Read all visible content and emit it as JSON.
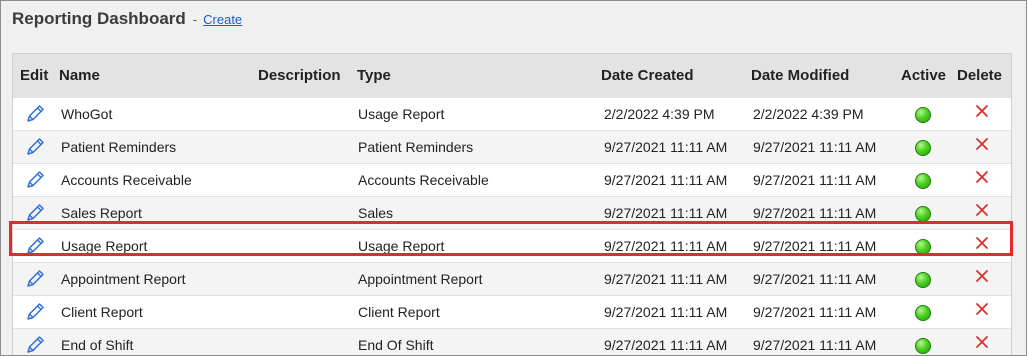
{
  "header": {
    "title": "Reporting Dashboard",
    "separator": "-",
    "create_link": "Create"
  },
  "table": {
    "columns": {
      "edit": "Edit",
      "name": "Name",
      "description": "Description",
      "type": "Type",
      "date_created": "Date Created",
      "date_modified": "Date Modified",
      "active": "Active",
      "delete": "Delete"
    },
    "rows": [
      {
        "name": "WhoGot",
        "description": "",
        "type": "Usage Report",
        "date_created": "2/2/2022 4:39 PM",
        "date_modified": "2/2/2022 4:39 PM",
        "active": true
      },
      {
        "name": "Patient Reminders",
        "description": "",
        "type": "Patient Reminders",
        "date_created": "9/27/2021 11:11 AM",
        "date_modified": "9/27/2021 11:11 AM",
        "active": true
      },
      {
        "name": "Accounts Receivable",
        "description": "",
        "type": "Accounts Receivable",
        "date_created": "9/27/2021 11:11 AM",
        "date_modified": "9/27/2021 11:11 AM",
        "active": true
      },
      {
        "name": "Sales Report",
        "description": "",
        "type": "Sales",
        "date_created": "9/27/2021 11:11 AM",
        "date_modified": "9/27/2021 11:11 AM",
        "active": true
      },
      {
        "name": "Usage Report",
        "description": "",
        "type": "Usage Report",
        "date_created": "9/27/2021 11:11 AM",
        "date_modified": "9/27/2021 11:11 AM",
        "active": true
      },
      {
        "name": "Appointment Report",
        "description": "",
        "type": "Appointment Report",
        "date_created": "9/27/2021 11:11 AM",
        "date_modified": "9/27/2021 11:11 AM",
        "active": true
      },
      {
        "name": "Client Report",
        "description": "",
        "type": "Client Report",
        "date_created": "9/27/2021 11:11 AM",
        "date_modified": "9/27/2021 11:11 AM",
        "active": true
      },
      {
        "name": "End of Shift",
        "description": "",
        "type": "End Of Shift",
        "date_created": "9/27/2021 11:11 AM",
        "date_modified": "9/27/2021 11:11 AM",
        "active": true
      }
    ],
    "highlighted_row": 4
  },
  "colors": {
    "highlight_border": "#e8272e",
    "link": "#1a5ccf",
    "edit_icon": "#2f6fd6",
    "delete_icon": "#d9302b",
    "active_green": "#3cc219"
  },
  "icons": {
    "edit": "pencil-icon",
    "active": "green-circle-icon",
    "delete": "close-x-icon"
  }
}
